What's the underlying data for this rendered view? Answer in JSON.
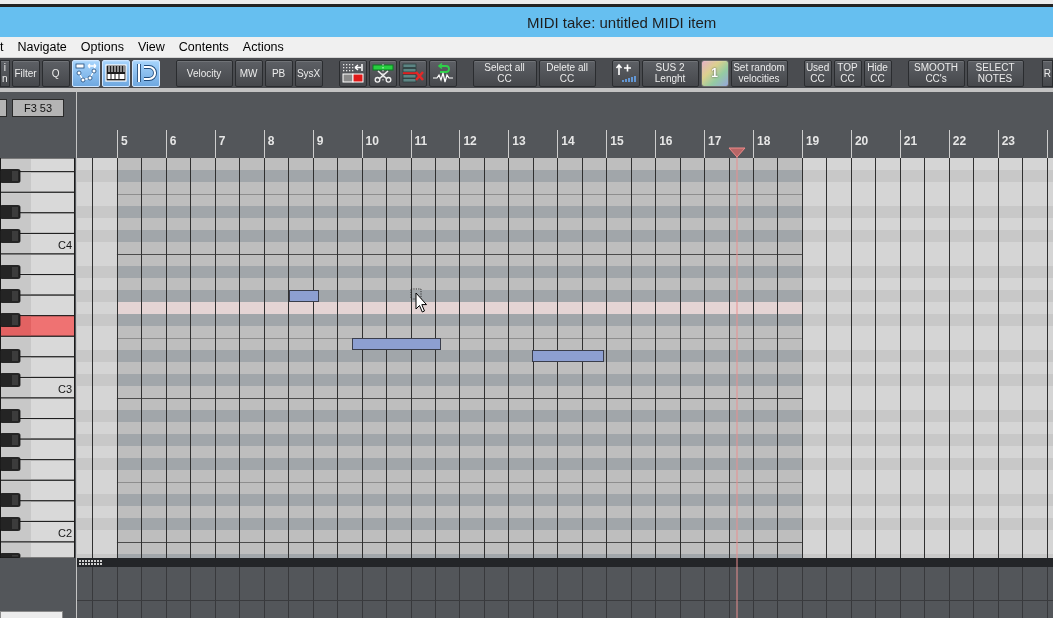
{
  "window": {
    "title": "MIDI take: untitled MIDI item"
  },
  "menu": [
    "t",
    "Navigate",
    "Options",
    "View",
    "Contents",
    "Actions"
  ],
  "toolbar": [
    {
      "buttons": [
        {
          "kind": "clipped",
          "lines": [
            "i",
            "n"
          ],
          "on": false
        },
        {
          "kind": "narrow",
          "lines": [
            "Filter"
          ],
          "on": false
        },
        {
          "kind": "narrow",
          "lines": [
            "Q"
          ],
          "on": false
        },
        {
          "kind": "nodes",
          "on": true
        },
        {
          "kind": "keys",
          "on": true
        },
        {
          "kind": "bracket",
          "on": true
        }
      ]
    },
    {
      "buttons": [
        {
          "kind": "wide",
          "lines": [
            "Velocity"
          ],
          "on": false
        },
        {
          "kind": "narrow",
          "lines": [
            "MW"
          ],
          "on": false
        },
        {
          "kind": "narrow",
          "lines": [
            "PB"
          ],
          "on": false
        },
        {
          "kind": "narrow",
          "lines": [
            "SysX"
          ],
          "on": false
        }
      ]
    },
    {
      "buttons": [
        {
          "kind": "bar-arrow",
          "on": false
        },
        {
          "kind": "scissors",
          "on": false
        },
        {
          "kind": "delete-list",
          "on": false
        },
        {
          "kind": "waveform",
          "on": false
        }
      ]
    },
    {
      "buttons": [
        {
          "kind": "wider",
          "lines": [
            "Select all",
            "CC"
          ],
          "on": false
        },
        {
          "kind": "wide",
          "lines": [
            "Delete all",
            "CC"
          ],
          "on": false
        }
      ]
    },
    {
      "buttons": [
        {
          "kind": "velocity-up",
          "on": false
        },
        {
          "kind": "wide",
          "lines": [
            "SUS 2",
            "Lenght"
          ],
          "on": false
        },
        {
          "kind": "gradient",
          "lines": [
            "1"
          ],
          "on": false
        },
        {
          "kind": "wide",
          "lines": [
            "Set random",
            "velocities"
          ],
          "on": false
        }
      ]
    },
    {
      "buttons": [
        {
          "kind": "narrow",
          "lines": [
            "Used",
            "CC"
          ],
          "on": false
        },
        {
          "kind": "narrow",
          "lines": [
            "TOP",
            "CC"
          ],
          "on": false
        },
        {
          "kind": "narrow",
          "lines": [
            "Hide",
            "CC"
          ],
          "on": false
        }
      ]
    },
    {
      "buttons": [
        {
          "kind": "wide",
          "lines": [
            "SMOOTH",
            "CC's"
          ],
          "on": false
        },
        {
          "kind": "wide",
          "lines": [
            "SELECT",
            "NOTES"
          ],
          "on": false
        }
      ]
    },
    {
      "buttons": [
        {
          "kind": "clipped",
          "lines": [
            "R"
          ],
          "on": false
        }
      ]
    }
  ],
  "note_info": {
    "value": "F3 53"
  },
  "ruler": {
    "bars": [
      "5",
      "6",
      "7",
      "8",
      "9",
      "10",
      "11",
      "12",
      "13",
      "14",
      "15",
      "16",
      "17",
      "18",
      "19",
      "20",
      "21",
      "22",
      "23"
    ]
  },
  "piano_roll": {
    "pitches": [
      {
        "kind": "white",
        "selected": false,
        "highlighted": false
      },
      {
        "kind": "black",
        "selected": false,
        "highlighted": false
      },
      {
        "kind": "white",
        "selected": false,
        "highlighted": false
      },
      {
        "kind": "white",
        "selected": false,
        "highlighted": false
      },
      {
        "kind": "black",
        "selected": false,
        "highlighted": false
      },
      {
        "kind": "white",
        "selected": false,
        "highlighted": false
      },
      {
        "kind": "black",
        "selected": false,
        "highlighted": false
      },
      {
        "kind": "white",
        "label": "C4",
        "selected": false,
        "highlighted": false
      },
      {
        "kind": "white",
        "selected": false,
        "highlighted": false
      },
      {
        "kind": "black",
        "selected": false,
        "highlighted": false
      },
      {
        "kind": "white",
        "selected": false,
        "highlighted": false
      },
      {
        "kind": "black",
        "selected": false,
        "highlighted": false
      },
      {
        "kind": "white",
        "selected": false,
        "highlighted": true
      },
      {
        "kind": "black",
        "selected": false,
        "highlighted": false
      },
      {
        "kind": "white",
        "selected": true,
        "highlighted": false
      },
      {
        "kind": "white",
        "selected": false,
        "highlighted": false
      },
      {
        "kind": "black",
        "selected": false,
        "highlighted": false
      },
      {
        "kind": "white",
        "selected": false,
        "highlighted": false
      },
      {
        "kind": "black",
        "selected": false,
        "highlighted": false
      },
      {
        "kind": "white",
        "label": "C3",
        "selected": false,
        "highlighted": false
      },
      {
        "kind": "white",
        "selected": false,
        "highlighted": false
      },
      {
        "kind": "black",
        "selected": false,
        "highlighted": false
      },
      {
        "kind": "white",
        "selected": false,
        "highlighted": false
      },
      {
        "kind": "black",
        "selected": false,
        "highlighted": false
      },
      {
        "kind": "white",
        "selected": false,
        "highlighted": false
      },
      {
        "kind": "black",
        "selected": false,
        "highlighted": false
      },
      {
        "kind": "white",
        "selected": false,
        "highlighted": false
      },
      {
        "kind": "white",
        "selected": false,
        "highlighted": false
      },
      {
        "kind": "black",
        "selected": false,
        "highlighted": false
      },
      {
        "kind": "white",
        "selected": false,
        "highlighted": false
      },
      {
        "kind": "black",
        "selected": false,
        "highlighted": false
      },
      {
        "kind": "white",
        "label": "C2",
        "selected": false,
        "highlighted": false
      },
      {
        "kind": "white",
        "selected": false,
        "highlighted": false
      },
      {
        "kind": "black",
        "selected": false,
        "highlighted": false
      }
    ]
  }
}
